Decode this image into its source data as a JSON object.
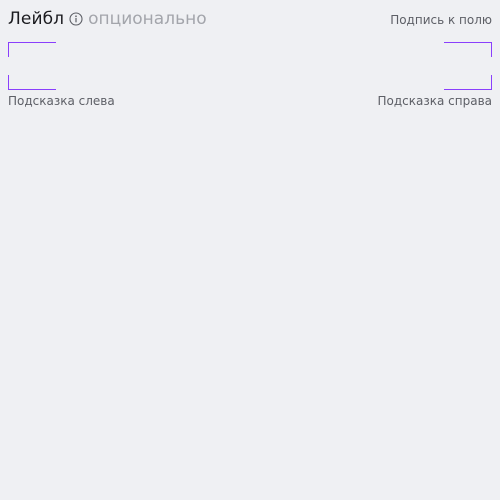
{
  "field": {
    "label": "Лейбл",
    "info_icon": "info-circle-icon",
    "optional": "опционально",
    "caption": "Подпись к полю",
    "input_value": "",
    "hint_left": "Подсказка слева",
    "hint_right": "Подсказка справа"
  },
  "colors": {
    "background": "#eff0f3",
    "accent": "#8a3ffc",
    "label": "#1b1b1f",
    "muted": "#a3a5ab",
    "secondary_text": "#5d5f66"
  }
}
